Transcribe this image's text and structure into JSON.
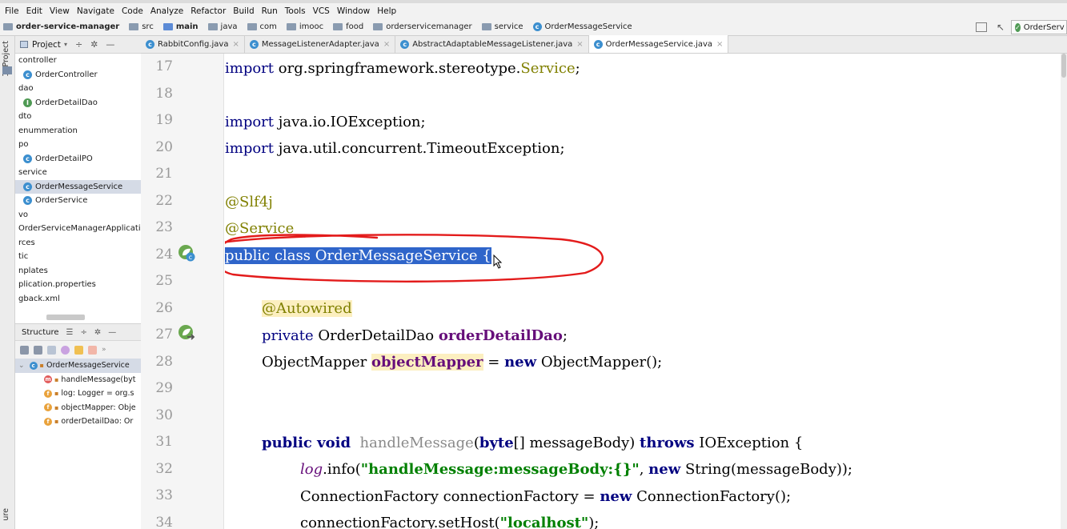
{
  "menubar": {
    "items": [
      "File",
      "Edit",
      "View",
      "Navigate",
      "Code",
      "Analyze",
      "Refactor",
      "Build",
      "Run",
      "Tools",
      "VCS",
      "Window",
      "Help"
    ]
  },
  "breadcrumb": {
    "items": [
      {
        "label": "order-service-manager",
        "bold": true
      },
      {
        "label": "src",
        "bold": false
      },
      {
        "label": "main",
        "bold": true
      },
      {
        "label": "java",
        "bold": false
      },
      {
        "label": "com",
        "bold": false
      },
      {
        "label": "imooc",
        "bold": false
      },
      {
        "label": "food",
        "bold": false
      },
      {
        "label": "orderservicemanager",
        "bold": false
      },
      {
        "label": "service",
        "bold": false
      },
      {
        "label": "OrderMessageService",
        "bold": false
      }
    ],
    "run_config": "OrderServ"
  },
  "left_strip": {
    "project_tab": "1: Project",
    "structure_tab": "ure"
  },
  "project_panel": {
    "title": "Project",
    "items": [
      {
        "label": "controller",
        "icon": "folder",
        "indent": 0
      },
      {
        "label": "OrderController",
        "icon": "class",
        "indent": 1
      },
      {
        "label": "dao",
        "icon": "folder",
        "indent": 0
      },
      {
        "label": "OrderDetailDao",
        "icon": "interface",
        "indent": 1
      },
      {
        "label": "dto",
        "icon": "folder",
        "indent": 0
      },
      {
        "label": "enummeration",
        "icon": "folder",
        "indent": 0
      },
      {
        "label": "po",
        "icon": "folder",
        "indent": 0
      },
      {
        "label": "OrderDetailPO",
        "icon": "class",
        "indent": 1
      },
      {
        "label": "service",
        "icon": "folder",
        "indent": 0
      },
      {
        "label": "OrderMessageService",
        "icon": "class",
        "indent": 1,
        "selected": true
      },
      {
        "label": "OrderService",
        "icon": "class",
        "indent": 1
      },
      {
        "label": "vo",
        "icon": "folder",
        "indent": 0
      },
      {
        "label": "OrderServiceManagerApplicati",
        "icon": "app",
        "indent": 0
      },
      {
        "label": "rces",
        "icon": "none",
        "indent": 0
      },
      {
        "label": "tic",
        "icon": "none",
        "indent": 0
      },
      {
        "label": "nplates",
        "icon": "none",
        "indent": 0
      },
      {
        "label": "plication.properties",
        "icon": "none",
        "indent": 0
      },
      {
        "label": "gback.xml",
        "icon": "none",
        "indent": 0
      }
    ]
  },
  "structure_panel": {
    "title": "Structure",
    "items": [
      {
        "label": "OrderMessageService",
        "badge": "c",
        "selected": true
      },
      {
        "label": "handleMessage(byt",
        "badge": "m"
      },
      {
        "label": "log: Logger = org.s",
        "badge": "f"
      },
      {
        "label": "objectMapper: Obje",
        "badge": "f"
      },
      {
        "label": "orderDetailDao: Or",
        "badge": "f"
      }
    ]
  },
  "tabs": [
    {
      "label": "RabbitConfig.java",
      "active": false
    },
    {
      "label": "MessageListenerAdapter.java",
      "active": false
    },
    {
      "label": "AbstractAdaptableMessageListener.java",
      "active": false
    },
    {
      "label": "OrderMessageService.java",
      "active": true
    }
  ],
  "editor": {
    "line_numbers": [
      "17",
      "18",
      "19",
      "20",
      "21",
      "22",
      "23",
      "24",
      "25",
      "26",
      "27",
      "28",
      "29",
      "30",
      "31",
      "32",
      "33",
      "34"
    ]
  },
  "colors": {
    "keyword": "#000080",
    "annotation": "#808000",
    "field": "#660e7a",
    "string": "#008000",
    "selection": "#2f65ca",
    "annotation_circle": "#e31b1b"
  }
}
